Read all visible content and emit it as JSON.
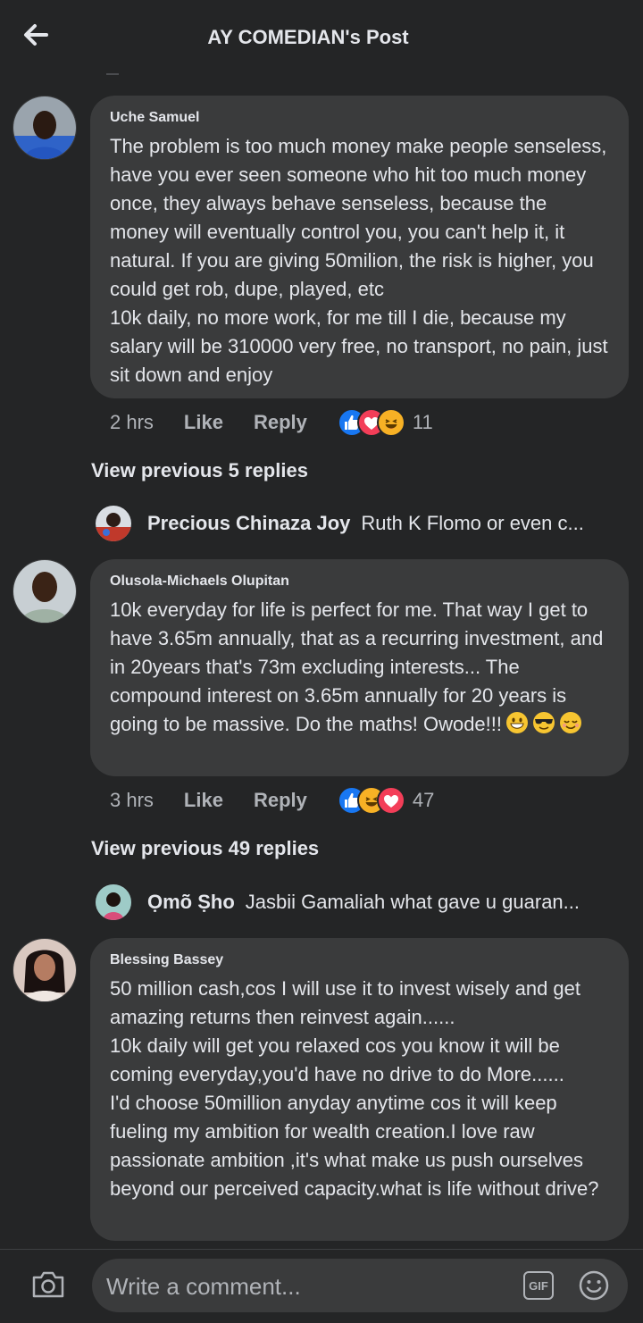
{
  "header": {
    "title": "AY COMEDIAN's Post",
    "back_icon": "arrow-left-icon"
  },
  "comments": [
    {
      "author": "Uche Samuel",
      "text": "The problem is too much money make people senseless, have you ever seen someone who hit too much money once, they always behave senseless, because the money will eventually control you, you can't help it, it natural. If you are giving 50milion, the risk is higher, you could get rob, dupe, played, etc\n10k daily, no more work, for me till I die, because my salary will be 310000 very free, no transport, no pain, just sit down and enjoy",
      "time": "2 hrs",
      "like_label": "Like",
      "reply_label": "Reply",
      "reactions": [
        "like",
        "love",
        "haha"
      ],
      "reaction_count": "11",
      "view_previous": "View previous 5 replies",
      "preview_reply": {
        "name": "Precious Chinaza Joy",
        "text": "Ruth K Flomo or even c..."
      }
    },
    {
      "author": "Olusola-Michaels Olupitan",
      "text": "10k everyday for life is perfect for me. That way I get to have 3.65m annually, that as a recurring investment, and in 20years that's 73m excluding interests... The compound interest on 3.65m annually for 20 years is going to be massive. Do the maths! Owode!!!",
      "text_emojis": [
        "grinning-face",
        "smiling-face-with-sunglasses",
        "relieved-face"
      ],
      "time": "3 hrs",
      "like_label": "Like",
      "reply_label": "Reply",
      "reactions": [
        "like",
        "haha",
        "love"
      ],
      "reaction_count": "47",
      "view_previous": "View previous 49 replies",
      "preview_reply": {
        "name": "Ọmõ Ṣho",
        "text": "Jasbii Gamaliah what gave u guaran..."
      }
    },
    {
      "author": "Blessing Bassey",
      "text": "50 million cash,cos I will use it to invest wisely and get amazing returns then reinvest again......\n10k daily will get you relaxed cos you know it will be coming everyday,you'd have no drive to do More......\nI'd choose 50million anyday anytime cos it will keep fueling my ambition for wealth creation.I love raw passionate  ambition ,it's what make us push ourselves beyond our perceived capacity.what is life without drive?"
    }
  ],
  "composer": {
    "placeholder": "Write a comment...",
    "gif_label": "GIF",
    "camera_icon": "camera-icon",
    "emoji_icon": "smiley-icon"
  },
  "colors": {
    "background": "#242526",
    "bubble": "#3a3b3c",
    "text_primary": "#e4e6eb",
    "text_secondary": "#b0b3b8",
    "like_blue": "#1877f2",
    "love_red": "#f33e58",
    "haha_yellow": "#f7b125"
  }
}
